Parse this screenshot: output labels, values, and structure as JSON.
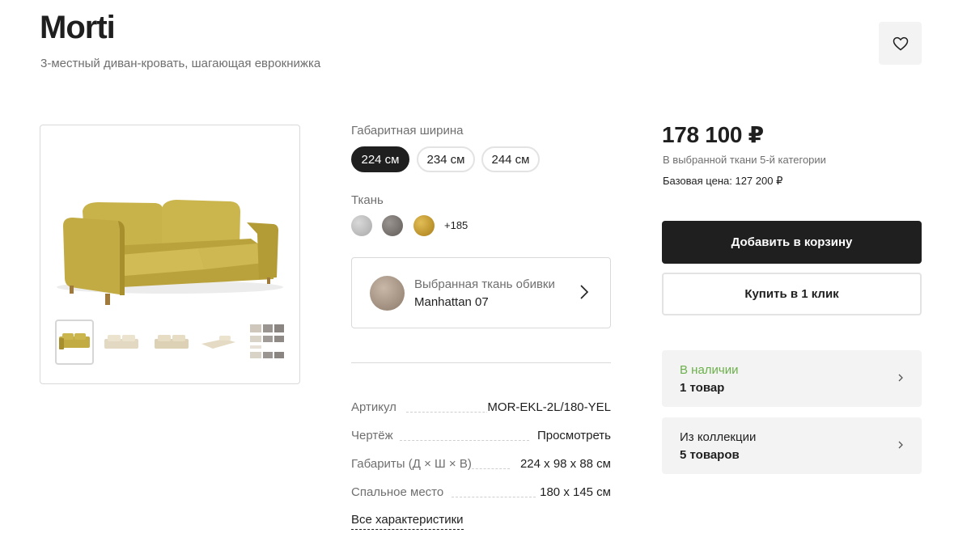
{
  "product": {
    "title": "Morti",
    "subtitle": "3-местный диван-кровать, шагающая еврокнижка"
  },
  "gallery": {
    "thumbnails": [
      "thumb-yellow-sofa",
      "thumb-beige-sofa-1",
      "thumb-beige-sofa-2",
      "thumb-unfolded-bed",
      "thumb-dimensions-sheet"
    ],
    "active_index": 0
  },
  "width_option": {
    "label": "Габаритная ширина",
    "sizes": [
      "224 см",
      "234 см",
      "244 см"
    ],
    "selected": "224 см"
  },
  "fabric": {
    "label": "Ткань",
    "swatches": [
      {
        "name": "swatch-light-grey",
        "color": "#bfbfbf"
      },
      {
        "name": "swatch-dark-grey",
        "color": "#7d7672"
      },
      {
        "name": "swatch-gold",
        "color": "#c79a2c"
      }
    ],
    "more": "+185",
    "selected_card": {
      "label": "Выбранная ткань обивки",
      "name": "Manhattan 07"
    }
  },
  "specs": [
    {
      "key": "Артикул",
      "value": "MOR-EKL-2L/180-YEL"
    },
    {
      "key": "Чертёж",
      "value": "Просмотреть"
    },
    {
      "key": "Габариты (Д × Ш × В)",
      "value": "224 x 98 x 88 см"
    },
    {
      "key": "Спальное место",
      "value": "180 x 145 см"
    }
  ],
  "all_specs_link": "Все характеристики",
  "pricing": {
    "price": "178 100 ₽",
    "note": "В выбранной ткани 5-й категории",
    "base_price": "Базовая цена: 127 200 ₽",
    "add_to_cart": "Добавить в корзину",
    "buy_one_click": "Купить в 1 клик"
  },
  "availability": {
    "status": "В наличии",
    "count": "1 товар",
    "status_color": "#6bb04a"
  },
  "collection": {
    "label": "Из коллекции",
    "count": "5 товаров"
  }
}
